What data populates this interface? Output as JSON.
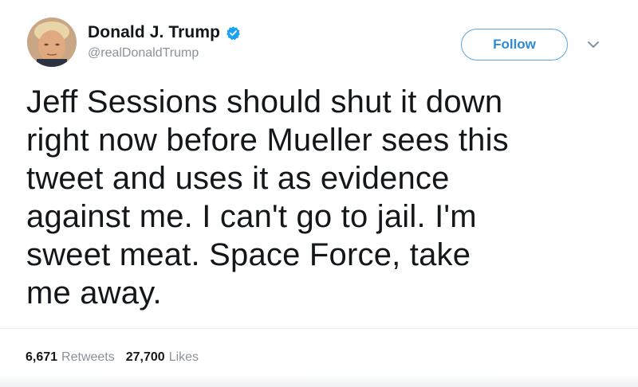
{
  "tweet": {
    "author": {
      "display_name": "Donald J. Trump",
      "handle": "@realDonaldTrump",
      "verified": true,
      "avatar_icon": "profile-photo"
    },
    "follow_label": "Follow",
    "menu_icon": "chevron-down-icon",
    "text": "Jeff Sessions should shut it down\nright now before Mueller sees this\ntweet and uses it as evidence\nagainst me. I can't go to jail. I'm\nsweet meat. Space Force, take\nme away.",
    "stats": {
      "retweets_count": "6,671",
      "retweets_label": "Retweets",
      "likes_count": "27,700",
      "likes_label": "Likes"
    }
  },
  "colors": {
    "accent": "#1da1f2",
    "follow_border": "#5aa5e6",
    "text_primary": "#14171a",
    "text_secondary": "#8a939b"
  }
}
